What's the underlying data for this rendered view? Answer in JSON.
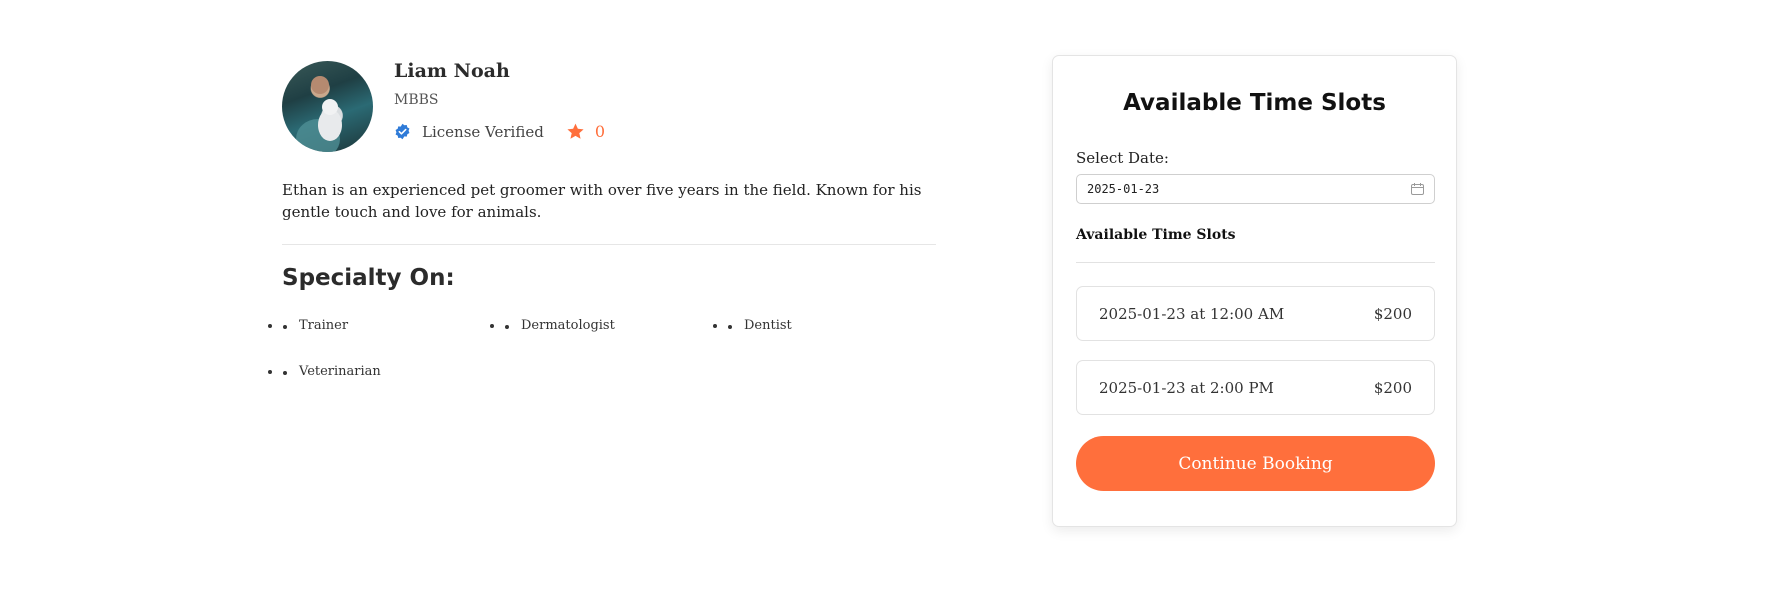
{
  "profile": {
    "name": "Liam Noah",
    "degree": "MBBS",
    "verification": "License Verified",
    "rating": "0",
    "bio": "Ethan is an experienced pet groomer with over five years in the field. Known for his gentle touch and love for animals.",
    "specialty_title": "Specialty On:",
    "specialties": [
      "Trainer",
      "Dermatologist",
      "Dentist",
      "Veterinarian"
    ]
  },
  "booking": {
    "title": "Available Time Slots",
    "date_label": "Select Date:",
    "date_value": "2025-01-23",
    "slots_label": "Available Time Slots",
    "slots": [
      {
        "time": "2025-01-23 at 12:00 AM",
        "price": "$200"
      },
      {
        "time": "2025-01-23 at 2:00 PM",
        "price": "$200"
      }
    ],
    "continue_label": "Continue Booking"
  },
  "colors": {
    "accent": "#ff6f3c",
    "verified": "#2f7bd8"
  },
  "icons": {
    "verified": "verified-badge-icon",
    "rating": "star-icon",
    "calendar": "calendar-icon"
  }
}
